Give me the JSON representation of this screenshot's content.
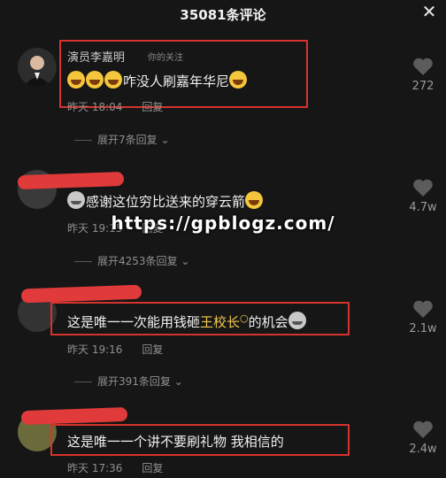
{
  "header": {
    "title": "35081条评论"
  },
  "comments": [
    {
      "username": "演员李嘉明",
      "follow_tag": "你的关注",
      "text": "咋没人刷嘉年华尼",
      "time": "昨天 18:04",
      "reply_label": "回复",
      "expand_label": "展开7条回复",
      "likes": "272"
    },
    {
      "text": "感谢这位穷比送来的穿云箭",
      "time": "昨天 19:15",
      "reply_label": "回复",
      "expand_label": "展开4253条回复",
      "likes": "4.7w"
    },
    {
      "text_before": "这是唯一一次能用钱砸",
      "text_highlight": "王校长",
      "text_after": "的机会",
      "time": "昨天 19:16",
      "reply_label": "回复",
      "expand_label": "展开391条回复",
      "likes": "2.1w"
    },
    {
      "text": "这是唯一一个讲不要刷礼物 我相信的",
      "time": "昨天 17:36",
      "reply_label": "回复",
      "likes": "2.4w"
    }
  ],
  "watermark": "https://gpblogz.com/",
  "icons": {
    "close": "close-icon",
    "like": "heart-icon",
    "expand": "chevron-down-icon",
    "laugh": "laughing-emoji",
    "cat": "cat-emoji",
    "search": "search-icon"
  },
  "colors": {
    "highlight": "#f3c94c",
    "annotation": "#d6332d",
    "background": "#161616"
  }
}
